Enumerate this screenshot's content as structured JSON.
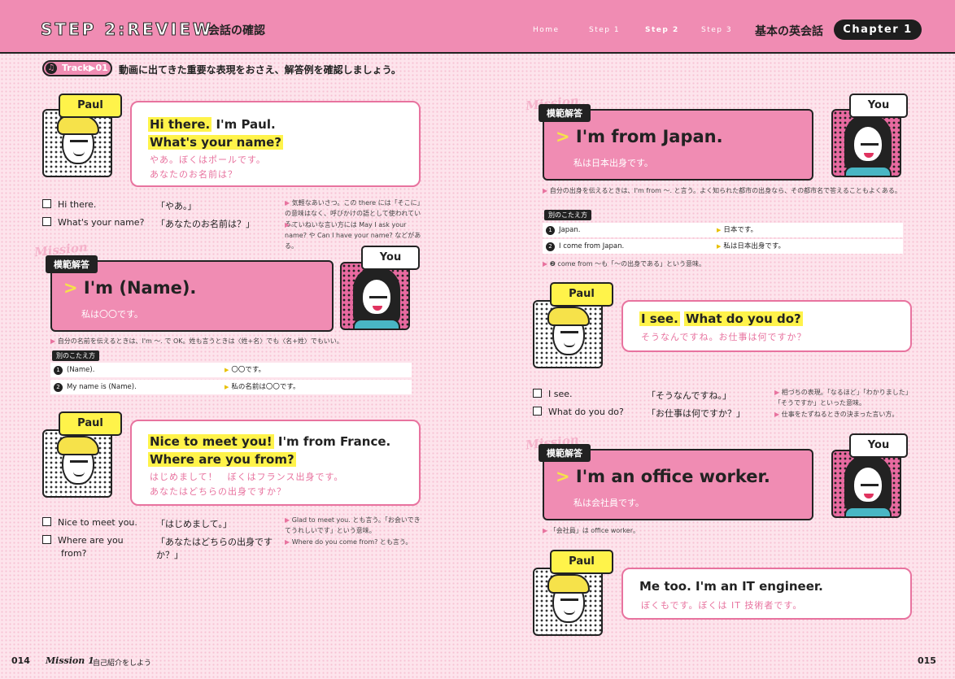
{
  "header": {
    "title": "STEP 2:REVIEW",
    "subtitle": "会話の確認",
    "nav": [
      "Home",
      "Step 1",
      "Step 2",
      "Step 3"
    ],
    "topic": "基本の英会話",
    "chapter": "Chapter 1"
  },
  "track": {
    "label": "Track▶01",
    "icon": "music-note-icon"
  },
  "intro": "動画に出てきた重要な表現をおさえ、解答例を確認しましょう。",
  "speakers": {
    "paul": "Paul",
    "you": "You"
  },
  "mission_word": "Mission",
  "mission_label": "模範解答",
  "alt_label": "別のこたえ方",
  "left": {
    "d1": {
      "en_hl1": "Hi there.",
      "en_rest1": " I'm Paul.",
      "en_hl2": "What's your name?",
      "jp1": "やあ。ぼくはポールです。",
      "jp2": "あなたのお名前は？"
    },
    "c1": [
      {
        "en": "Hi there.",
        "jp": "「やあ。」"
      },
      {
        "en": "What's your name?",
        "jp": "「あなたのお名前は？」"
      }
    ],
    "n1": [
      "気軽なあいさつ。この there には「そこに」の意味はなく、呼びかけの語として使われている。",
      "ていねいな言い方には May I ask your name? や Can I have your name? などがある。"
    ],
    "m1": {
      "en": "I'm (Name).",
      "jp": "私は〇〇です。",
      "note": "自分の名前を伝えるときは、I'm ～. で OK。姓も言うときは〈姓+名〉でも〈名+姓〉でもいい。",
      "alts": [
        {
          "en": "(Name).",
          "jp": "〇〇です。"
        },
        {
          "en": "My name is (Name).",
          "jp": "私の名前は〇〇です。"
        }
      ]
    },
    "d2": {
      "en_hl1": "Nice to meet you!",
      "en_rest1": " I'm from France.",
      "en_hl2": "Where are you from?",
      "jp1": "はじめまして！　ぼくはフランス出身です。",
      "jp2": "あなたはどちらの出身ですか？"
    },
    "c2": [
      {
        "en": "Nice to meet you.",
        "jp": "「はじめまして。」"
      },
      {
        "en": "Where are you",
        "en2": "from?",
        "jp": "「あなたはどちらの出身です",
        "jp2": "か？」"
      }
    ],
    "n2": [
      "Glad to meet you. とも言う。「お会いできてうれしいです」という意味。",
      "Where do you come from? とも言う。"
    ]
  },
  "right": {
    "m2": {
      "en": "I'm from Japan.",
      "jp": "私は日本出身です。",
      "note": "自分の出身を伝えるときは、I'm from ～. と言う。よく知られた都市の出身なら、その都市名で答えることもよくある。",
      "alts": [
        {
          "en": "Japan.",
          "jp": "日本です。"
        },
        {
          "en": "I come from Japan.",
          "jp": "私は日本出身です。"
        }
      ],
      "note2": "❷ come from ～も「～の出身である」という意味。"
    },
    "d3": {
      "en_hl1": "I see.",
      "en_hl2": "What do you do?",
      "jp1": "そうなんですね。お仕事は何ですか？"
    },
    "c3": [
      {
        "en": "I see.",
        "jp": "「そうなんですね。」"
      },
      {
        "en": "What do you do?",
        "jp": "「お仕事は何ですか？」"
      }
    ],
    "n3": [
      "相づちの表現。「なるほど」「わかりました」「そうですか」といった意味。",
      "仕事をたずねるときの決まった言い方。"
    ],
    "m3": {
      "en": "I'm an office worker.",
      "jp": "私は会社員です。",
      "note": "「会社員」は office worker。"
    },
    "d4": {
      "en": "Me too.  I'm an IT engineer.",
      "jp1": "ぼくもです。ぼくは IT 技術者です。"
    }
  },
  "footer": {
    "left_page": "014",
    "mission": "Mission 1",
    "left_title": "自己紹介をしよう",
    "right_page": "015"
  }
}
